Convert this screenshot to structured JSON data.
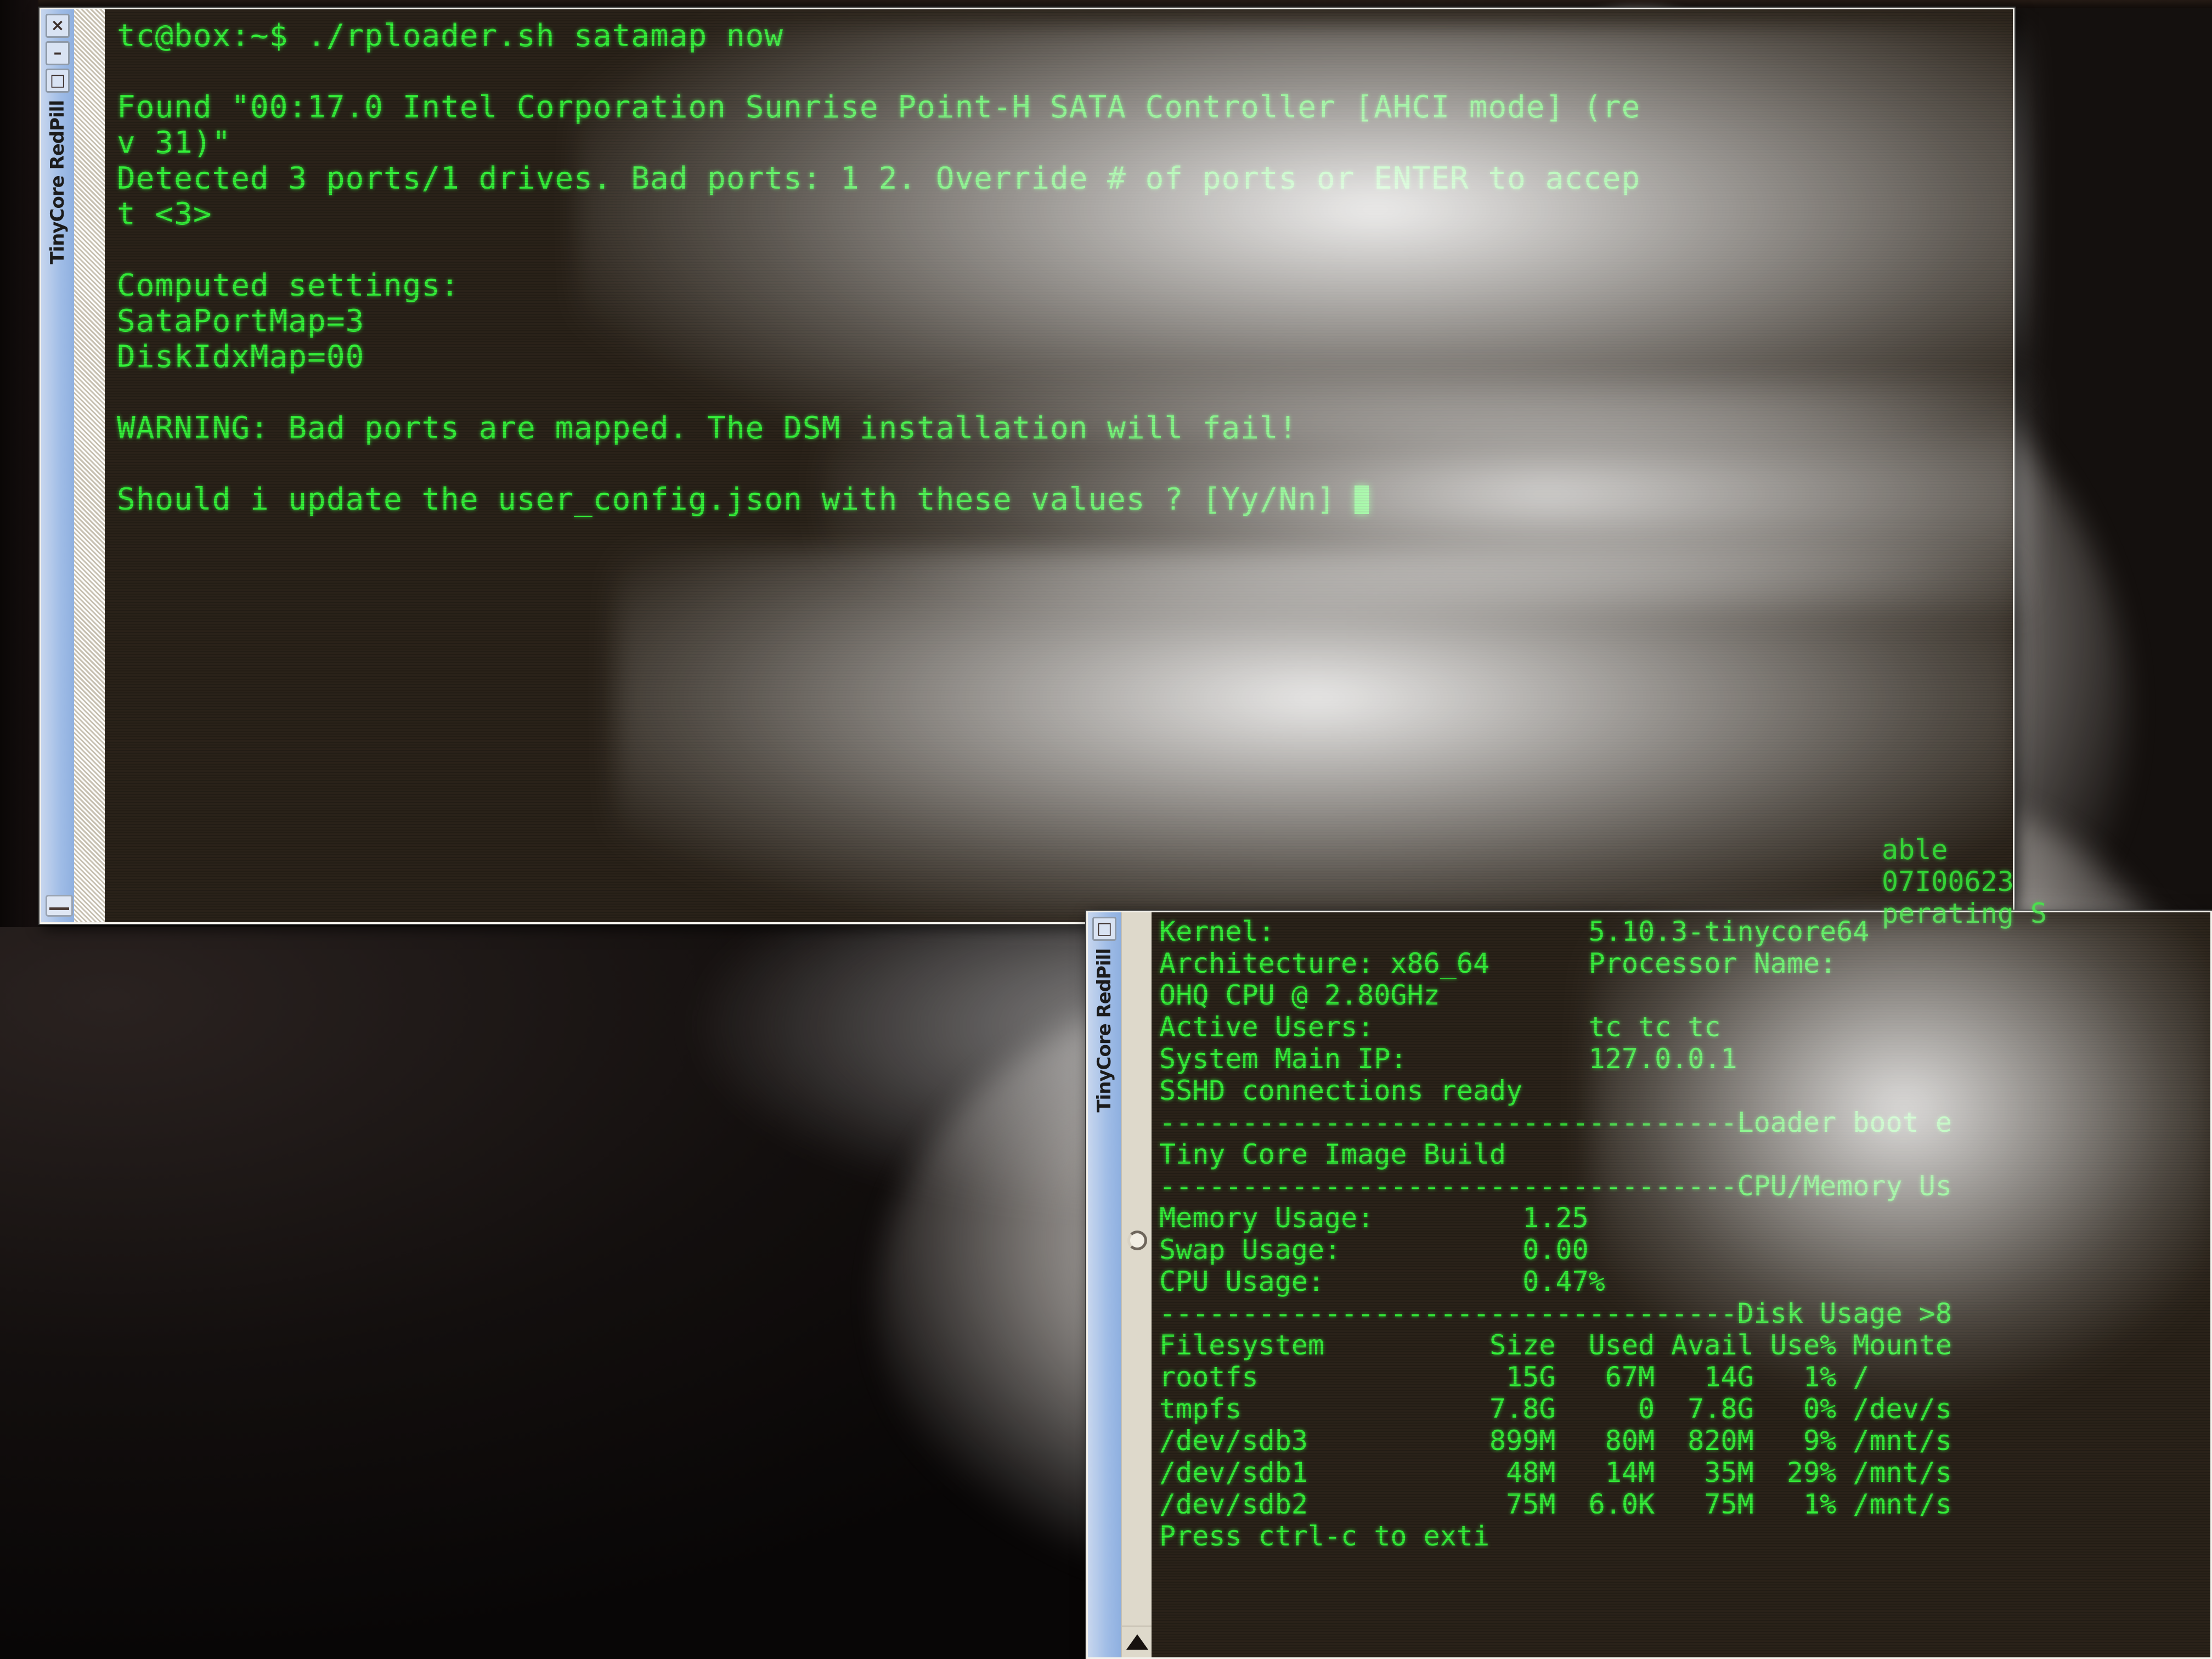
{
  "window_main": {
    "title": "TinyCore RedPill",
    "buttons": [
      {
        "name": "close",
        "glyph": "×"
      },
      {
        "name": "minimize",
        "glyph": "–"
      },
      {
        "name": "maximize",
        "glyph": "□"
      }
    ],
    "terminal_lines": [
      "tc@box:~$ ./rploader.sh satamap now",
      "",
      "Found \"00:17.0 Intel Corporation Sunrise Point-H SATA Controller [AHCI mode] (re",
      "v 31)\"",
      "Detected 3 ports/1 drives. Bad ports: 1 2. Override # of ports or ENTER to accep",
      "t <3>",
      "",
      "Computed settings:",
      "SataPortMap=3",
      "DiskIdxMap=00",
      "",
      "WARNING: Bad ports are mapped. The DSM installation will fail!",
      "",
      "Should i update the user_config.json with these values ? [Yy/Nn] "
    ],
    "command": "./rploader.sh satamap now",
    "prompt": "tc@box:~$",
    "values": {
      "sata_port_map": "SataPortMap=3",
      "disk_idx_map": "DiskIdxMap=00",
      "ports_detected": "3",
      "drives_detected": "1",
      "bad_ports": "1 2",
      "default_accept": "<3>",
      "answer_choices": "[Yy/Nn]"
    }
  },
  "window_status": {
    "title": "TinyCore RedPill",
    "buttons": [
      {
        "name": "maximize",
        "glyph": "□"
      }
    ],
    "info_rows": [
      {
        "label": "Kernel:",
        "value": "5.10.3-tinycore64"
      },
      {
        "label": "Architecture: x86_64",
        "value": "Processor Name:"
      },
      {
        "label": "OHQ CPU @ 2.80GHz",
        "value": ""
      },
      {
        "label": "Active Users:",
        "value": "tc tc tc"
      },
      {
        "label": "System Main IP:",
        "value": "127.0.0.1"
      },
      {
        "label": "SSHD connections ready",
        "value": ""
      }
    ],
    "partial_top_lines": [
      "able",
      "07I00623",
      "perating S"
    ],
    "separators": [
      {
        "text": "-----------------------------------Loader boot e"
      },
      {
        "text": "-----------------------------------CPU/Memory Us"
      },
      {
        "text": "-----------------------------------Disk Usage >8"
      }
    ],
    "section_title": "Tiny Core Image Build",
    "usage_rows": [
      {
        "label": "Memory Usage:",
        "value": "1.25"
      },
      {
        "label": "Swap Usage:",
        "value": "0.00"
      },
      {
        "label": "CPU Usage:",
        "value": "0.47%"
      }
    ],
    "disk_table": {
      "headers": [
        "Filesystem",
        "Size",
        "Used",
        "Avail",
        "Use%",
        "Mounte"
      ],
      "rows": [
        [
          "rootfs",
          "15G",
          "67M",
          "14G",
          "1%",
          "/"
        ],
        [
          "tmpfs",
          "7.8G",
          "0",
          "7.8G",
          "0%",
          "/dev/s"
        ],
        [
          "/dev/sdb3",
          "899M",
          "80M",
          "820M",
          "9%",
          "/mnt/s"
        ],
        [
          "/dev/sdb1",
          "48M",
          "14M",
          "35M",
          "29%",
          "/mnt/s"
        ],
        [
          "/dev/sdb2",
          "75M",
          "6.0K",
          "75M",
          "1%",
          "/mnt/s"
        ]
      ]
    },
    "footer": "Press ctrl-c to exti"
  },
  "colors": {
    "terminal_green": "#35f03a",
    "terminal_bg": "#2a2219",
    "titlebar_blue": "#9fbce6",
    "window_face": "#e9e6dd"
  }
}
